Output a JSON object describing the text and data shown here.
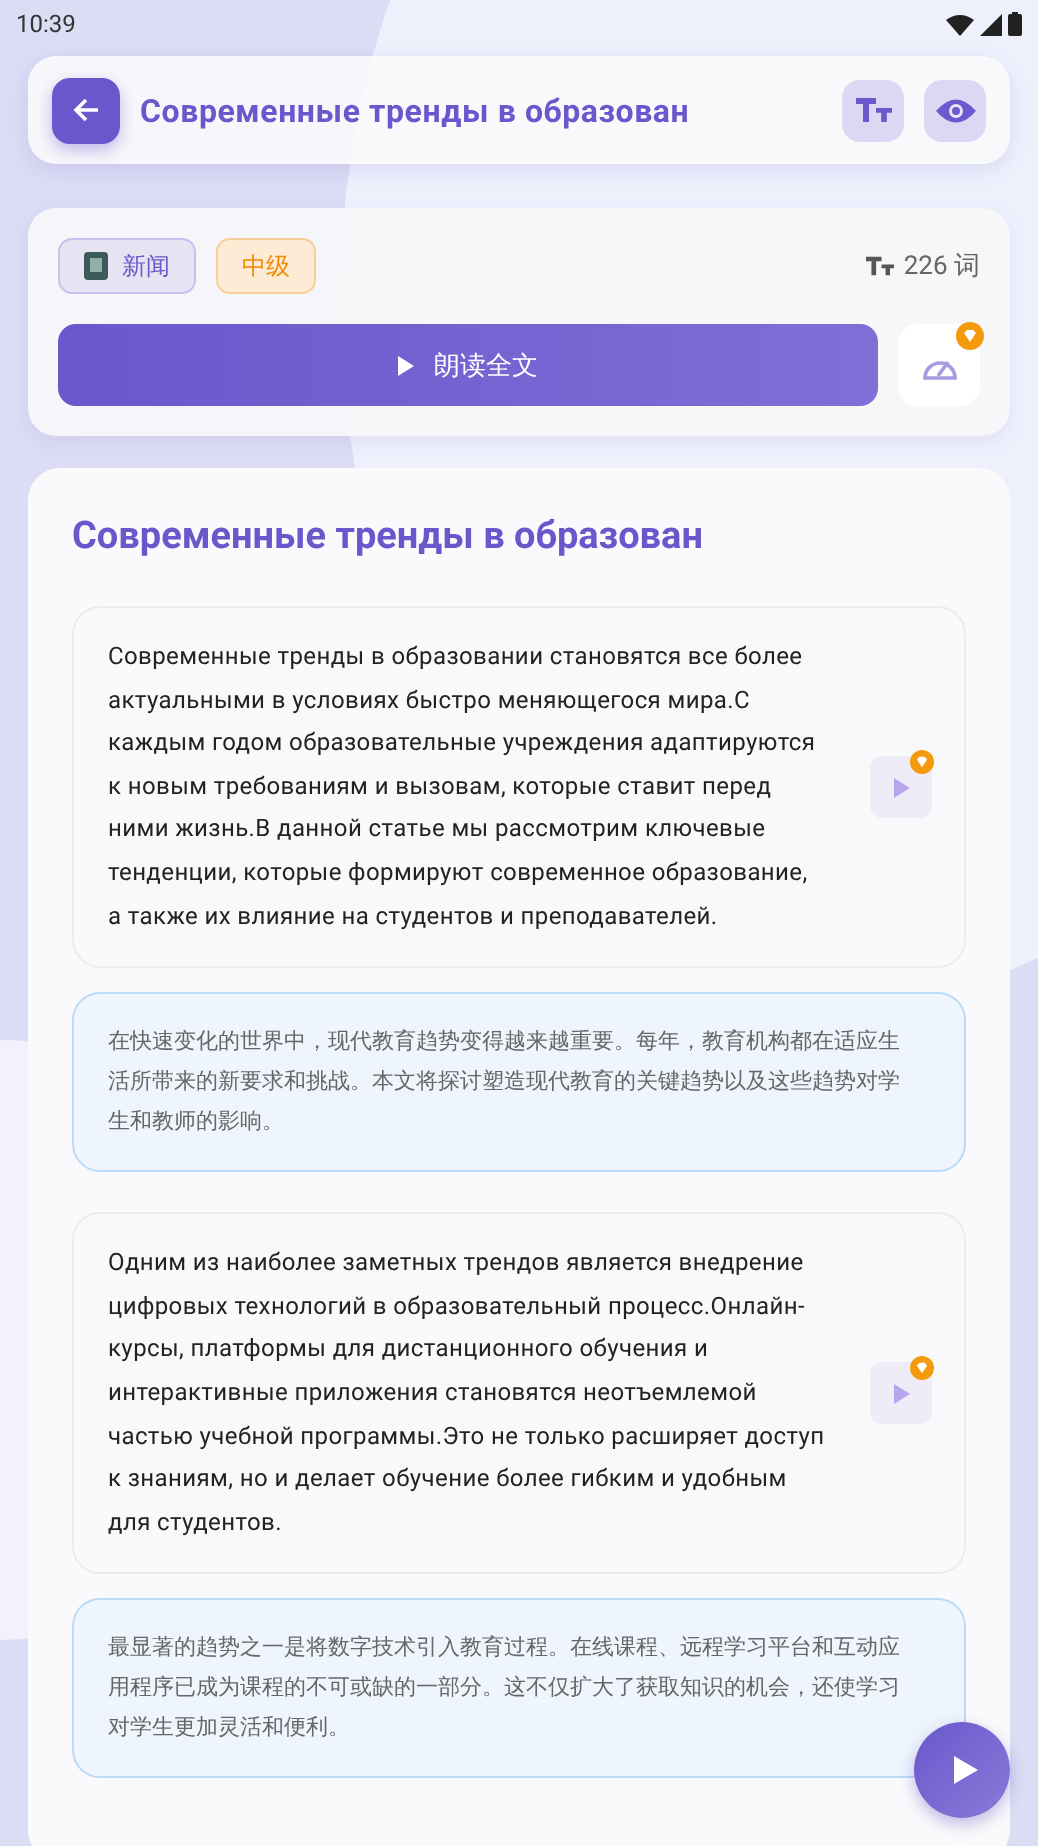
{
  "status_bar": {
    "time": "10:39"
  },
  "header": {
    "title": "Современные тренды в образован"
  },
  "meta": {
    "category": "新闻",
    "level_tag": "中级",
    "word_count": "226 词",
    "read_button": "朗读全文"
  },
  "article": {
    "title": "Современные тренды в образован",
    "blocks": [
      {
        "kind": "original",
        "text": "Современные тренды в образовании становятся все более актуальными в условиях быстро меняющегося мира.С каждым годом образовательные учреждения адаптируются к новым требованиям и вызовам, которые ставит перед ними жизнь.В данной статье мы рассмотрим ключевые тенденции, которые формируют современное образование, а также их влияние на студентов и преподавателей."
      },
      {
        "kind": "translation",
        "text": "在快速变化的世界中，现代教育趋势变得越来越重要。每年，教育机构都在适应生活所带来的新要求和挑战。本文将探讨塑造现代教育的关键趋势以及这些趋势对学生和教师的影响。"
      },
      {
        "kind": "original",
        "text": "Одним из наиболее заметных трендов является внедрение цифровых технологий в образовательный процесс.Онлайн-курсы, платформы для дистанционного обучения и интерактивные приложения становятся неотъемлемой частью учебной программы.Это не только расширяет доступ к знаниям, но и делает обучение более гибким и удобным для студентов."
      },
      {
        "kind": "translation",
        "text": "最显著的趋势之一是将数字技术引入教育过程。在线课程、远程学习平台和互动应用程序已成为课程的不可或缺的一部分。这不仅扩大了获取知识的机会，还使学习对学生更加灵活和便利。"
      }
    ]
  }
}
